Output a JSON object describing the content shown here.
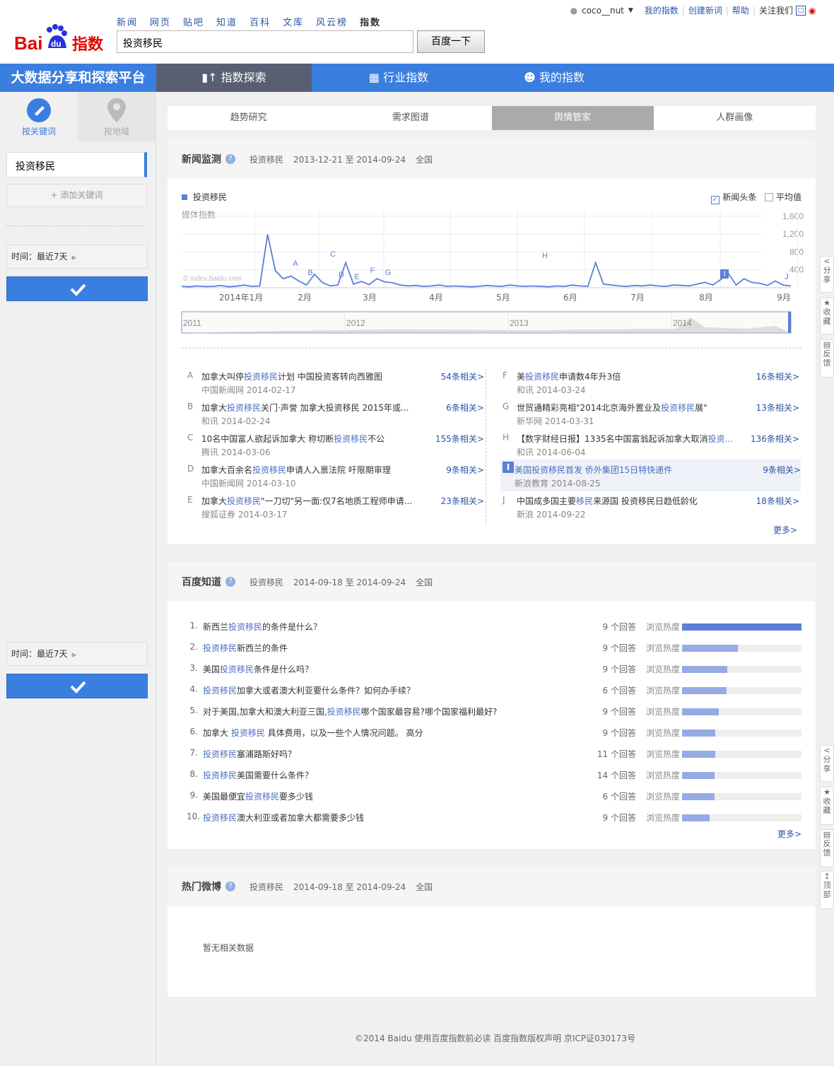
{
  "header": {
    "logo_text": "Baidu指数",
    "topnav": [
      "新闻",
      "网页",
      "贴吧",
      "知道",
      "百科",
      "文库",
      "风云榜",
      "指数"
    ],
    "search_value": "投资移民",
    "search_button": "百度一下",
    "user": "coco__nut",
    "links": [
      "我的指数",
      "创建新词",
      "帮助",
      "关注我们"
    ]
  },
  "nav": {
    "brand": "大数据分享和探索平台",
    "tabs": [
      "指数探索",
      "行业指数",
      "我的指数"
    ]
  },
  "sidebar": {
    "tab_keyword": "按关键词",
    "tab_region": "按地域",
    "keyword": "投资移民",
    "add_keyword": "添加关键词",
    "time_label": "时间：最近7天"
  },
  "subtabs": [
    "趋势研究",
    "需求图谱",
    "舆情管家",
    "人群画像"
  ],
  "news": {
    "title": "新闻监测",
    "keyword": "投资移民",
    "range": "2013-12-21 至 2014-09-24",
    "region": "全国",
    "legend": "投资移民",
    "check_headline": "新闻头条",
    "check_avg": "平均值",
    "ylabel": "媒体指数",
    "watermark": "© index.baidu.com",
    "more": "更多>",
    "items_left": [
      {
        "letter": "A",
        "pre": "加拿大叫停",
        "hl": "投资移民",
        "post": "计划 中国投资客转向西雅图",
        "source": "中国新闻网 2014-02-17",
        "related": "54条相关>"
      },
      {
        "letter": "B",
        "pre": "加拿大",
        "hl": "投资移民",
        "post": "关门·声誉 加拿大投资移民 2015年或...",
        "source": "和讯 2014-02-24",
        "related": "6条相关>"
      },
      {
        "letter": "C",
        "pre": "10名中国富人欲起诉加拿大 称切断",
        "hl": "投资移民",
        "post": "不公",
        "source": "腾讯 2014-03-06",
        "related": "155条相关>"
      },
      {
        "letter": "D",
        "pre": "加拿大百余名",
        "hl": "投资移民",
        "post": "申请人入禀法院 吁限期审理",
        "source": "中国新闻网 2014-03-10",
        "related": "9条相关>"
      },
      {
        "letter": "E",
        "pre": "加拿大",
        "hl": "投资移民",
        "post": "\"一刀切\"另一面:仅7名地质工程师申请...",
        "source": "搜狐证券 2014-03-17",
        "related": "23条相关>"
      }
    ],
    "items_right": [
      {
        "letter": "F",
        "pre": "美",
        "hl": "投资移民",
        "post": "申请数4年升3倍",
        "source": "和讯 2014-03-24",
        "related": "16条相关>"
      },
      {
        "letter": "G",
        "pre": "世贸通精彩亮相\"2014北京海外置业及",
        "hl": "投资移民",
        "post": "展\"",
        "source": "新华网 2014-03-31",
        "related": "13条相关>"
      },
      {
        "letter": "H",
        "pre": "【数字财经日报】1335名中国富翁起诉加拿大取消",
        "hl": "投资...",
        "post": "",
        "source": "和讯 2014-06-04",
        "related": "136条相关>"
      },
      {
        "letter": "I",
        "pre": "美国投资移民首发 侨外集团15日特快递件",
        "hl": "",
        "post": "",
        "source": "新浪教育 2014-08-25",
        "related": "9条相关>"
      },
      {
        "letter": "J",
        "pre": "中国成多国主要",
        "hl": "移民",
        "post": "来源国 投资移民日趋低龄化",
        "source": "新浪 2014-09-22",
        "related": "18条相关>"
      }
    ]
  },
  "chart_data": {
    "type": "line",
    "ylabel": "媒体指数",
    "yticks": [
      "1,600",
      "1,200",
      "800",
      "400"
    ],
    "xticks": [
      "2014年1月",
      "2月",
      "3月",
      "4月",
      "5月",
      "6月",
      "7月",
      "8月",
      "9月"
    ],
    "ylim": [
      0,
      1600
    ],
    "series": [
      {
        "name": "投资移民",
        "values": [
          30,
          20,
          40,
          25,
          30,
          50,
          20,
          35,
          60,
          30,
          40,
          1190,
          380,
          200,
          260,
          150,
          60,
          300,
          120,
          40,
          60,
          560,
          80,
          140,
          70,
          200,
          130,
          110,
          60,
          40,
          50,
          30,
          40,
          60,
          30,
          40,
          30,
          20,
          30,
          50,
          40,
          30,
          60,
          40,
          30,
          40,
          30,
          20,
          40,
          30,
          60,
          40,
          30,
          560,
          80,
          60,
          40,
          30,
          50,
          40,
          60,
          40,
          30,
          60,
          50,
          40,
          80,
          120,
          60,
          180,
          320,
          60,
          200,
          120,
          100,
          50,
          150,
          60,
          40
        ]
      }
    ],
    "markers": [
      "A",
      "B",
      "C",
      "D",
      "E",
      "F",
      "G",
      "H",
      "I",
      "J"
    ],
    "overview_years": [
      "2011",
      "2012",
      "2013",
      "2014"
    ]
  },
  "zhidao": {
    "title": "百度知道",
    "keyword": "投资移民",
    "range": "2014-09-18 至 2014-09-24",
    "region": "全国",
    "heat_label": "浏览热度",
    "more": "更多>",
    "questions": [
      {
        "n": "1.",
        "pre": "新西兰",
        "hl": "投资移民",
        "post": "的条件是什么？",
        "count": "9 个回答",
        "heat": 1.0
      },
      {
        "n": "2.",
        "pre": "",
        "hl": "投资移民",
        "post": "新西兰的条件",
        "count": "9 个回答",
        "heat": 0.47
      },
      {
        "n": "3.",
        "pre": "美国",
        "hl": "投资移民",
        "post": "条件是什么吗？",
        "count": "9 个回答",
        "heat": 0.38
      },
      {
        "n": "4.",
        "pre": "",
        "hl": "投资移民",
        "post": "加拿大或者澳大利亚要什么条件？如何办手续？",
        "count": "6 个回答",
        "heat": 0.37
      },
      {
        "n": "5.",
        "pre": "对于美国,加拿大和澳大利亚三国,",
        "hl": "投资移民",
        "post": "哪个国家最容易?哪个国家福利最好?",
        "count": "9 个回答",
        "heat": 0.31
      },
      {
        "n": "6.",
        "pre": "加拿大 ",
        "hl": "投资移民",
        "post": " 具体费用，以及一些个人情况问题。 高分",
        "count": "9 个回答",
        "heat": 0.28
      },
      {
        "n": "7.",
        "pre": "",
        "hl": "投资移民",
        "post": "塞浦路斯好吗？",
        "count": "11 个回答",
        "heat": 0.28
      },
      {
        "n": "8.",
        "pre": "",
        "hl": "投资移民",
        "post": "美国需要什么条件？",
        "count": "14 个回答",
        "heat": 0.27
      },
      {
        "n": "9.",
        "pre": "美国最便宜",
        "hl": "投资移民",
        "post": "要多少钱",
        "count": "6 个回答",
        "heat": 0.27
      },
      {
        "n": "10.",
        "pre": "",
        "hl": "投资移民",
        "post": "澳大利亚或者加拿大都需要多少钱",
        "count": "9 个回答",
        "heat": 0.23
      }
    ]
  },
  "weibo": {
    "title": "热门微博",
    "keyword": "投资移民",
    "range": "2014-09-18 至 2014-09-24",
    "region": "全国",
    "empty": "暂无相关数据"
  },
  "floatbar": {
    "share": "分享",
    "fav": "收藏",
    "feedback": "反馈",
    "top": "顶部"
  },
  "footer": "©2014 Baidu  使用百度指数前必读   百度指数版权声明  京ICP证030173号",
  "colors": {
    "accent": "#3a7ee0",
    "active_tab": "#585f72",
    "link": "#2a55a5",
    "line": "#5b7fd6"
  }
}
